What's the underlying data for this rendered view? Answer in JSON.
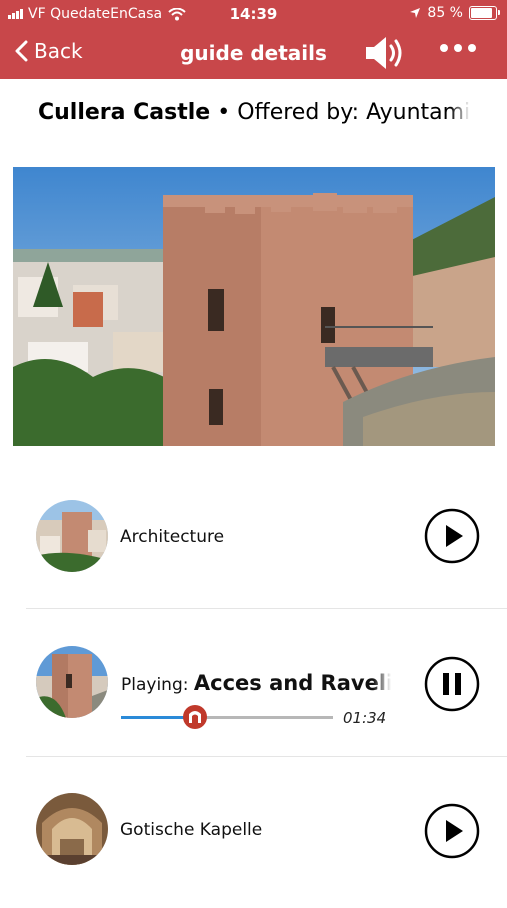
{
  "status_bar": {
    "carrier": "VF QuedateEnCasa",
    "time": "14:39",
    "battery": "85 %"
  },
  "nav": {
    "back_label": "Back",
    "title": "guide details"
  },
  "guide": {
    "name": "Cullera Castle",
    "separator": "•",
    "offered_prefix": "Offered by:",
    "offered_by": "Ayuntami"
  },
  "tracks": [
    {
      "title": "Architecture",
      "state": "play"
    },
    {
      "playing_prefix": "Playing:",
      "title": "Acces and Raveli",
      "state": "pause",
      "elapsed": "01:34",
      "progress": 0.35
    },
    {
      "title": "Gotische Kapelle",
      "state": "play"
    }
  ],
  "colors": {
    "header": "#c8474a",
    "progress": "#2a8ad8",
    "knob": "#c0392b"
  },
  "icons": [
    "wifi-icon",
    "location-arrow-icon",
    "battery-icon",
    "chevron-left-icon",
    "speaker-icon",
    "more-icon",
    "play-icon",
    "pause-icon"
  ]
}
